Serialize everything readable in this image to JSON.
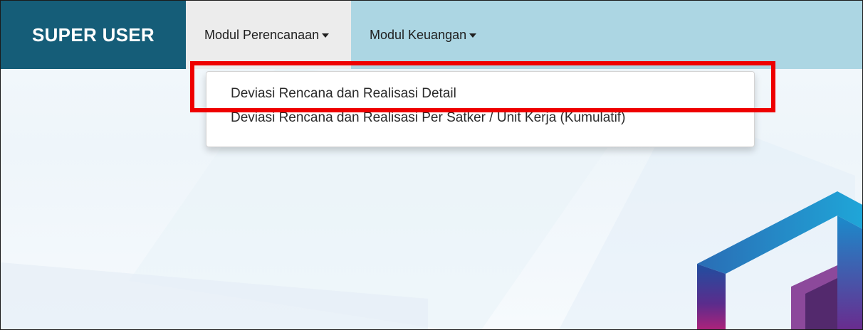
{
  "navbar": {
    "brand": "SUPER USER",
    "menus": [
      {
        "label": "Modul Perencanaan",
        "active": true
      },
      {
        "label": "Modul Keuangan",
        "active": false
      }
    ]
  },
  "dropdown": {
    "items": [
      {
        "label": "Deviasi Rencana dan Realisasi Detail",
        "highlighted": true
      },
      {
        "label": "Deviasi Rencana dan Realisasi Per Satker / Unit Kerja (Kumulatif)",
        "highlighted": false
      }
    ]
  },
  "colors": {
    "brand_bg": "#155d78",
    "navbar_bg": "#acd6e3",
    "active_menu_bg": "#ececec",
    "highlight": "#ee0000"
  },
  "icons": [
    "caret-down-icon",
    "cube-logo-icon"
  ]
}
